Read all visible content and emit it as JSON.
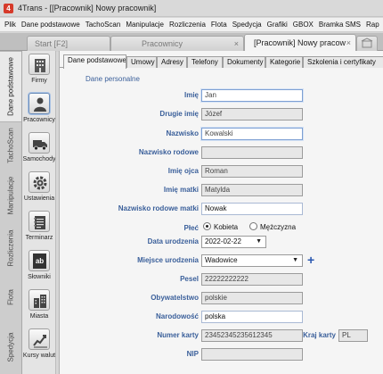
{
  "window": {
    "title": "4Trans - [[Pracownik] Nowy pracownik]",
    "app_icon_glyph": "4"
  },
  "menu": [
    "Plik",
    "Dane podstawowe",
    "TachoScan",
    "Manipulacje",
    "Rozliczenia",
    "Flota",
    "Spedycja",
    "Grafiki",
    "GBOX",
    "Bramka SMS",
    "Rap"
  ],
  "doc_tabs": [
    {
      "label": "Start [F2]",
      "active": false
    },
    {
      "label": "Pracownicy",
      "active": false,
      "close": "×"
    },
    {
      "label": "[Pracownik] Nowy pracow",
      "active": true,
      "close": "×"
    }
  ],
  "categories": [
    "Dane podstawowe",
    "TachoScan",
    "Manipulacje",
    "Rozliczenia",
    "Flota",
    "Spedycja"
  ],
  "sidebar": [
    {
      "label": "Firmy",
      "icon": "building-icon"
    },
    {
      "label": "Pracownicy",
      "icon": "person-icon"
    },
    {
      "label": "Samochody",
      "icon": "truck-icon"
    },
    {
      "label": "Ustawienia",
      "icon": "gear-icon"
    },
    {
      "label": "Terminarz",
      "icon": "calendar-icon"
    },
    {
      "label": "Słowniki",
      "icon": "dictionary-icon",
      "glyph": "ab"
    },
    {
      "label": "Miasta",
      "icon": "city-icon"
    },
    {
      "label": "Kursy walut",
      "icon": "chart-icon"
    }
  ],
  "subtabs": [
    "Dane podstawowe",
    "Umowy",
    "Adresy",
    "Telefony",
    "Dokumenty",
    "Kategorie",
    "Szkolenia i certyfikaty"
  ],
  "form": {
    "section_title": "Dane personalne",
    "imie": {
      "label": "Imię",
      "value": "Jan"
    },
    "drugie_imie": {
      "label": "Drugie imię",
      "value": "Józef"
    },
    "nazwisko": {
      "label": "Nazwisko",
      "value": "Kowalski"
    },
    "nazwisko_rodowe": {
      "label": "Nazwisko rodowe",
      "value": ""
    },
    "imie_ojca": {
      "label": "Imię ojca",
      "value": "Roman"
    },
    "imie_matki": {
      "label": "Imię matki",
      "value": "Matylda"
    },
    "nazwisko_rodowe_matki": {
      "label": "Nazwisko rodowe matki",
      "value": "Nowak"
    },
    "plec": {
      "label": "Płeć",
      "options": [
        "Kobieta",
        "Mężczyzna"
      ],
      "selected": "Kobieta"
    },
    "data_urodzenia": {
      "label": "Data urodzenia",
      "value": "2022-02-22"
    },
    "miejsce_urodzenia": {
      "label": "Miejsce urodzenia",
      "value": "Wadowice"
    },
    "pesel": {
      "label": "Pesel",
      "value": "22222222222"
    },
    "obywatelstwo": {
      "label": "Obywatelstwo",
      "value": "polskie"
    },
    "narodowosc": {
      "label": "Narodowość",
      "value": "polska"
    },
    "numer_karty": {
      "label": "Numer karty",
      "value": "23452345235612345"
    },
    "kraj_karty": {
      "label": "Kraj karty",
      "value": "PL"
    },
    "nip": {
      "label": "NIP",
      "value": ""
    },
    "add_glyph": "+",
    "dropdown_glyph": "▼"
  },
  "colors": {
    "label_blue": "#3a5f9a",
    "add_blue": "#2a58b0",
    "brand_red": "#d63a2a"
  }
}
